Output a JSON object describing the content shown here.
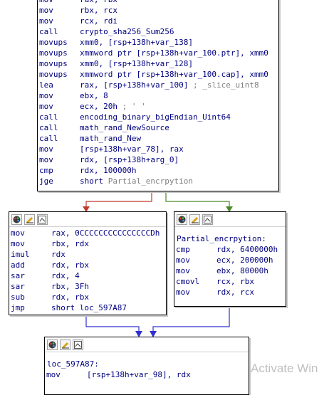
{
  "colors": {
    "instr": "#000080",
    "comment": "#808080",
    "edge_false": "#c0392b",
    "edge_true": "#4a8a2a",
    "edge_uncond": "#3030d0"
  },
  "block_top": {
    "lines": [
      {
        "mn": "mov",
        "op": "rax, rbx"
      },
      {
        "mn": "mov",
        "op": "rbx, rcx"
      },
      {
        "mn": "mov",
        "op": "rcx, rdi"
      },
      {
        "mn": "call",
        "op": "crypto_sha256_Sum256"
      },
      {
        "mn": "movups",
        "op": "xmm0, [rsp+138h+var_138]"
      },
      {
        "mn": "movups",
        "op": "xmmword ptr [rsp+138h+var_100.ptr], xmm0"
      },
      {
        "mn": "movups",
        "op": "xmm0, [rsp+138h+var_128]"
      },
      {
        "mn": "movups",
        "op": "xmmword ptr [rsp+138h+var_100.cap], xmm0"
      },
      {
        "mn": "lea",
        "op": "rax, [rsp+138h+var_100]",
        "comment": " ; _slice_uint8"
      },
      {
        "mn": "mov",
        "op": "ebx, 8"
      },
      {
        "mn": "mov",
        "op": "ecx, 20h",
        "comment": " ; ' '"
      },
      {
        "mn": "call",
        "op": "encoding_binary_bigEndian_Uint64"
      },
      {
        "mn": "call",
        "op": "math_rand_NewSource"
      },
      {
        "mn": "call",
        "op": "math_rand_New"
      },
      {
        "mn": "mov",
        "op": "[rsp+138h+var_78], rax"
      },
      {
        "mn": "mov",
        "op": "rdx, [rsp+138h+arg_0]"
      },
      {
        "mn": "cmp",
        "op": "rdx, 100000h"
      },
      {
        "mn": "jge",
        "op": "short ",
        "comment": "Partial_encrpytion"
      }
    ]
  },
  "block_left": {
    "lines": [
      {
        "mn": "mov",
        "op": "rax, 0CCCCCCCCCCCCCCCDh"
      },
      {
        "mn": "mov",
        "op": "rbx, rdx"
      },
      {
        "mn": "imul",
        "op": "rdx"
      },
      {
        "mn": "add",
        "op": "rdx, rbx"
      },
      {
        "mn": "sar",
        "op": "rdx, 4"
      },
      {
        "mn": "sar",
        "op": "rbx, 3Fh"
      },
      {
        "mn": "sub",
        "op": "rdx, rbx"
      },
      {
        "mn": "jmp",
        "op": "short loc_597A87"
      }
    ]
  },
  "block_right": {
    "label": "Partial_encrpytion:",
    "lines": [
      {
        "mn": "cmp",
        "op": "rdx, 6400000h"
      },
      {
        "mn": "mov",
        "op": "ecx, 200000h"
      },
      {
        "mn": "mov",
        "op": "ebx, 80000h"
      },
      {
        "mn": "cmovl",
        "op": "rcx, rbx"
      },
      {
        "mn": "mov",
        "op": "rdx, rcx"
      }
    ]
  },
  "block_bottom": {
    "label": "loc_597A87:",
    "lines": [
      {
        "mn": "mov",
        "op": "[rsp+138h+var_98], rdx"
      }
    ]
  },
  "header_icons": [
    "palette-icon",
    "rename-icon",
    "graph-view-icon"
  ],
  "watermark": "Activate Win"
}
